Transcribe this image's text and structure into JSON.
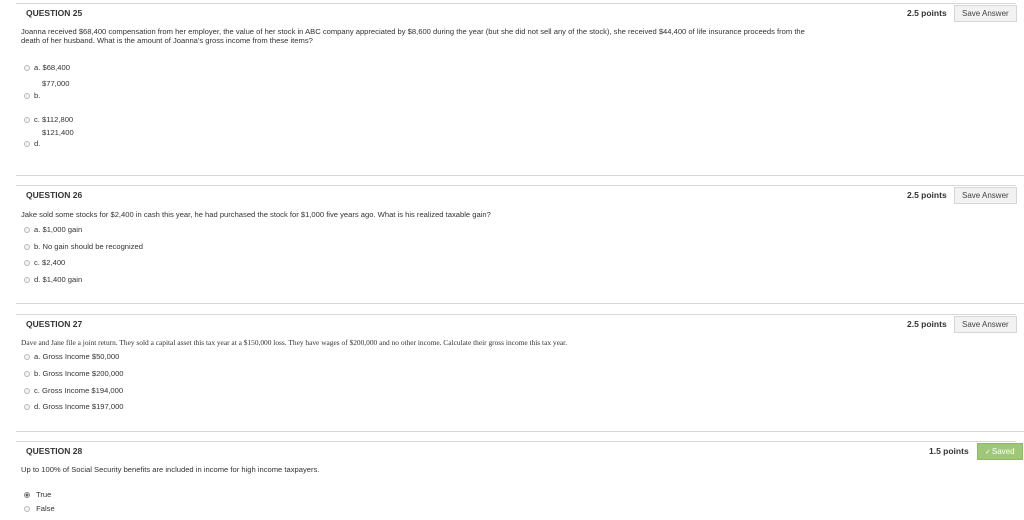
{
  "q25": {
    "title": "QUESTION 25",
    "points": "2.5 points",
    "save_label": "Save Answer",
    "text": "Joanna received $68,400 compensation from her employer, the value of her stock in ABC company appreciated by $8,600 during the year (but she did not sell any of the stock), she received $44,400 of life insurance proceeds from the death of her husband. What is the amount of Joanna's gross income from these items?",
    "options": [
      {
        "letter": "a.",
        "text": "$68,400"
      },
      {
        "letter": "b.",
        "text": "$77,000"
      },
      {
        "letter": "c.",
        "text": "$112,800"
      },
      {
        "letter": "d.",
        "text": "$121,400"
      }
    ]
  },
  "q26": {
    "title": "QUESTION 26",
    "points": "2.5 points",
    "save_label": "Save Answer",
    "text": "Jake sold some stocks for $2,400 in cash this year, he had purchased the stock for $1,000 five years ago. What is his realized taxable gain?",
    "options": [
      {
        "letter": "a.",
        "text": "$1,000 gain"
      },
      {
        "letter": "b.",
        "text": "No gain should be recognized"
      },
      {
        "letter": "c.",
        "text": "$2,400"
      },
      {
        "letter": "d.",
        "text": "$1,400 gain"
      }
    ]
  },
  "q27": {
    "title": "QUESTION 27",
    "points": "2.5 points",
    "save_label": "Save Answer",
    "text": "Dave and Jane file a joint return. They sold a capital asset this tax year at a $150,000 loss. They have wages of $200,000 and no other income. Calculate their gross income this tax year.",
    "options": [
      {
        "letter": "a.",
        "text": "Gross Income $50,000"
      },
      {
        "letter": "b.",
        "text": "Gross Income $200,000"
      },
      {
        "letter": "c.",
        "text": "Gross Income $194,000"
      },
      {
        "letter": "d.",
        "text": "Gross Income $197,000"
      }
    ]
  },
  "q28": {
    "title": "QUESTION 28",
    "points": "1.5 points",
    "saved_label": "Saved",
    "text": "Up to 100% of Social Security benefits are included in income for high income taxpayers.",
    "options": [
      {
        "text": "True",
        "selected": true
      },
      {
        "text": "False",
        "selected": false
      }
    ]
  }
}
